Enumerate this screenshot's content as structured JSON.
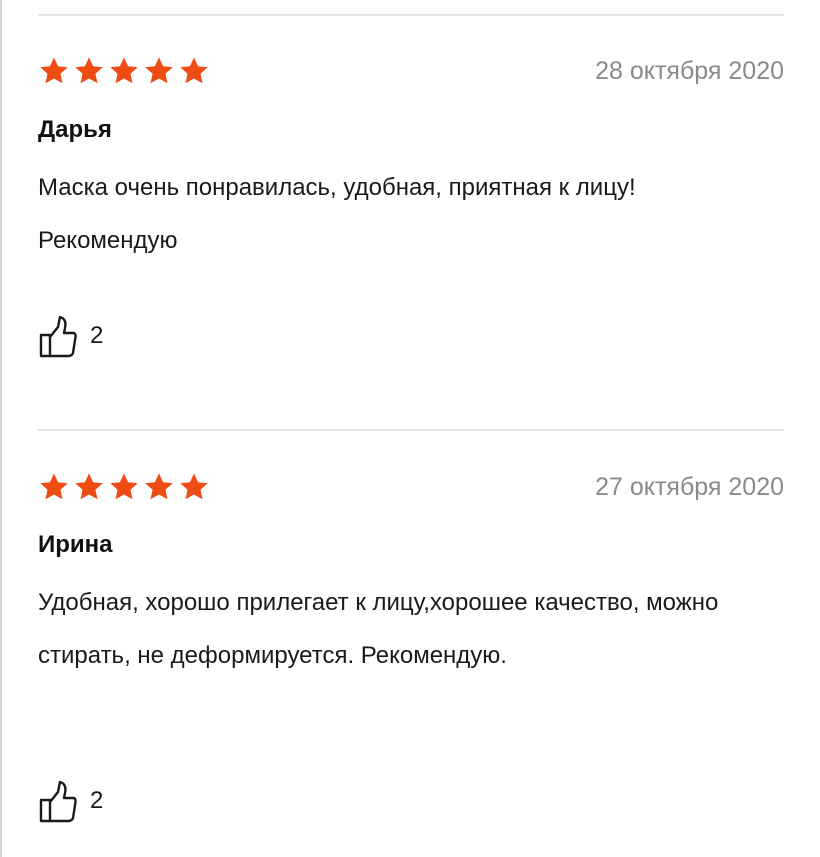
{
  "reviews": [
    {
      "rating": 5,
      "max_rating": 5,
      "date": "28 октября 2020",
      "author": "Дарья",
      "text": "Маска очень понравилась,  удобная, приятная к лицу! Рекомендую",
      "likes": "2"
    },
    {
      "rating": 5,
      "max_rating": 5,
      "date": "27 октября 2020",
      "author": "Ирина",
      "text": "Удобная, хорошо прилегает к лицу,хорошее качество, можно стирать, не деформируется. Рекомендую.",
      "likes": "2"
    }
  ],
  "icons": {
    "star": "star-icon",
    "like": "thumbs-up-icon"
  },
  "colors": {
    "star": "#ee4c12",
    "date": "#8a8a8a",
    "divider": "#e6e6e6"
  }
}
